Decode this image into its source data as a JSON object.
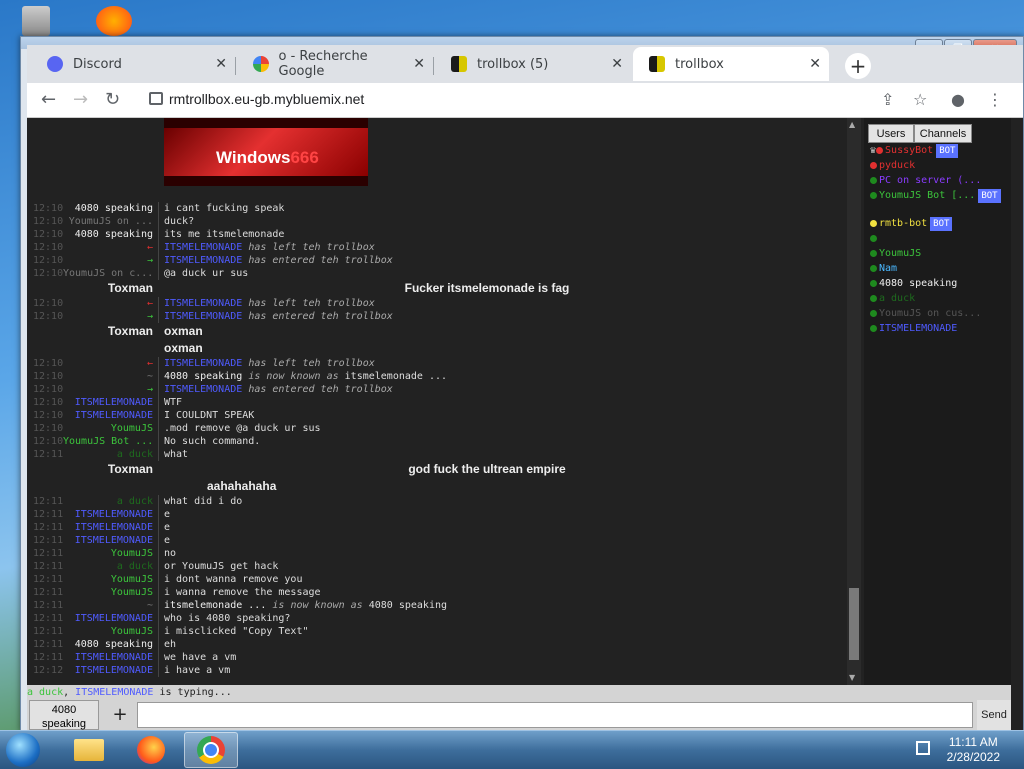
{
  "browser": {
    "tabs": [
      {
        "title": "Discord",
        "icon": "discord-icon"
      },
      {
        "title": "o - Recherche Google",
        "icon": "google-icon"
      },
      {
        "title": "trollbox (5)",
        "icon": "trollbox-icon"
      },
      {
        "title": "trollbox",
        "icon": "trollbox-icon"
      }
    ],
    "url": "rmtrollbox.eu-gb.mybluemix.net"
  },
  "chat": {
    "image_caption": {
      "brand": "Windows",
      "version": "666"
    },
    "messages": [
      {
        "time": "12:10",
        "nick": "4080 speaking",
        "text": "i cant fucking speak"
      },
      {
        "time": "12:10",
        "nick": "YoumuJS on ...",
        "text": "duck?"
      },
      {
        "time": "12:10",
        "nick": "4080 speaking",
        "text": "its me itsmelemonade"
      },
      {
        "time": "12:10",
        "nick": "←",
        "user": "ITSMELEMONADE",
        "text": "has left teh trollbox"
      },
      {
        "time": "12:10",
        "nick": "→",
        "user": "ITSMELEMONADE",
        "text": "has entered teh trollbox"
      },
      {
        "time": "12:10",
        "nick": "YoumuJS on c...",
        "text": "@a duck ur sus"
      },
      {
        "nick": "Toxman",
        "text": "Fucker itsmelemonade is fag"
      },
      {
        "time": "12:10",
        "nick": "←",
        "user": "ITSMELEMONADE",
        "text": "has left teh trollbox"
      },
      {
        "time": "12:10",
        "nick": "→",
        "user": "ITSMELEMONADE",
        "text": "has entered teh trollbox"
      },
      {
        "nick": "Toxman",
        "text": "oxman"
      },
      {
        "text": "oxman"
      },
      {
        "time": "12:10",
        "nick": "←",
        "user": "ITSMELEMONADE",
        "text": "has left teh trollbox"
      },
      {
        "time": "12:10",
        "nick": "~",
        "user": "4080 speaking",
        "text": "is now known as",
        "extra": "itsmelemonade ..."
      },
      {
        "time": "12:10",
        "nick": "→",
        "user": "ITSMELEMONADE",
        "text": "has entered teh trollbox"
      },
      {
        "time": "12:10",
        "nick": "ITSMELEMONADE",
        "text": "WTF"
      },
      {
        "time": "12:10",
        "nick": "ITSMELEMONADE",
        "text": "I COULDNT SPEAK"
      },
      {
        "time": "12:10",
        "nick": "YoumuJS",
        "text": ".mod remove @a duck ur sus"
      },
      {
        "time": "12:10",
        "nick": "YoumuJS Bot ...",
        "text": "No such command."
      },
      {
        "time": "12:11",
        "nick": "a duck",
        "text": "what"
      },
      {
        "nick": "Toxman",
        "text": "god fuck the ultrean empire"
      },
      {
        "text": "aahahahaha"
      },
      {
        "time": "12:11",
        "nick": "a duck",
        "text": "what did i do"
      },
      {
        "time": "12:11",
        "nick": "ITSMELEMONADE",
        "text": "e"
      },
      {
        "time": "12:11",
        "nick": "ITSMELEMONADE",
        "text": "e"
      },
      {
        "time": "12:11",
        "nick": "ITSMELEMONADE",
        "text": "e"
      },
      {
        "time": "12:11",
        "nick": "YoumuJS",
        "text": "no"
      },
      {
        "time": "12:11",
        "nick": "a duck",
        "text": "or YoumuJS get hack"
      },
      {
        "time": "12:11",
        "nick": "YoumuJS",
        "text": "i dont wanna remove you"
      },
      {
        "time": "12:11",
        "nick": "YoumuJS",
        "text": "i wanna remove the message"
      },
      {
        "time": "12:11",
        "nick": "~",
        "user": "itsmelemonade ...",
        "text": "is now known as",
        "extra": "4080 speaking"
      },
      {
        "time": "12:11",
        "nick": "ITSMELEMONADE",
        "text": "who is 4080 speaking?"
      },
      {
        "time": "12:11",
        "nick": "YoumuJS",
        "text": "i misclicked \"Copy Text\""
      },
      {
        "time": "12:11",
        "nick": "4080 speaking",
        "text": "eh"
      },
      {
        "time": "12:11",
        "nick": "ITSMELEMONADE",
        "text": "we have a vm"
      },
      {
        "time": "12:12",
        "nick": "ITSMELEMONADE",
        "text": "i have a vm"
      }
    ],
    "typing": {
      "users": [
        "a duck",
        "ITSMELEMONADE"
      ],
      "suffix": "is typing..."
    }
  },
  "sidebar": {
    "tabs": [
      "Users",
      "Channels"
    ],
    "users": [
      {
        "name": "SussyBot",
        "color": "#e23030",
        "bot": "BOT",
        "prefix": "♛"
      },
      {
        "name": "pyduck",
        "color": "#e23030"
      },
      {
        "name": "PC on server (...",
        "color": "#8a3cff"
      },
      {
        "name": "YoumuJS Bot [...",
        "color": "#3cc43c",
        "bot": "BOT"
      },
      {
        "name": "rmtb-bot",
        "color": "#f0e040",
        "bot": "BOT"
      },
      {
        "name": "",
        "color": "#3cc43c"
      },
      {
        "name": "YoumuJS",
        "color": "#3cc43c"
      },
      {
        "name": "Nam",
        "color": "#4ab8ff"
      },
      {
        "name": "4080 speaking",
        "color": "#eeeeee"
      },
      {
        "name": "a duck",
        "color": "#1e6a1e"
      },
      {
        "name": "YoumuJS on cus...",
        "color": "#555555"
      },
      {
        "name": "ITSMELEMONADE",
        "color": "#4f5bff"
      }
    ]
  },
  "composer": {
    "nick_button": "4080 speaking",
    "add_button": "+",
    "send_button": "Send"
  },
  "taskbar": {
    "time": "11:11 AM",
    "date": "2/28/2022"
  }
}
